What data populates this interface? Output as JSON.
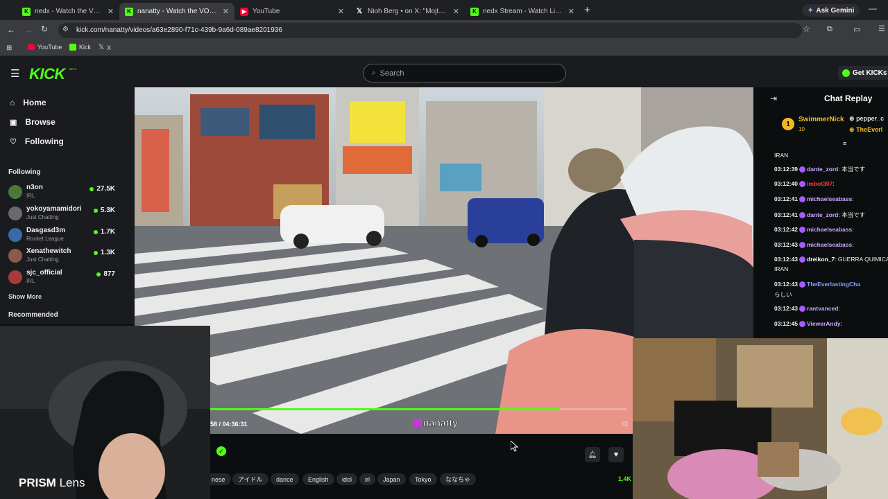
{
  "browser": {
    "tabs": [
      {
        "title": "nedx - Watch the VOD on Kick",
        "favicon": "kick",
        "active": false
      },
      {
        "title": "nanatty - Watch the VOD on Kick",
        "favicon": "kick",
        "active": true
      },
      {
        "title": "YouTube",
        "favicon": "youtube",
        "active": false
      },
      {
        "title": "Nioh Berg • on X: \"Mojtaba",
        "favicon": "x",
        "active": false
      },
      {
        "title": "nedx Stream - Watch Live on Kick",
        "favicon": "kick",
        "active": false
      }
    ],
    "new_tab": "+",
    "ask_gemini": "Ask Gemini",
    "url": "kick.com/nanatty/videos/a63e2890-f71c-439b-9a6d-089ae8201936",
    "bookmarks": [
      "YouTube",
      "Kick",
      "X"
    ]
  },
  "header": {
    "logo": "KICK",
    "search_placeholder": "Search",
    "get_kicks": "Get KICKs"
  },
  "sidebar": {
    "nav": [
      "Home",
      "Browse",
      "Following"
    ],
    "following_title": "Following",
    "following": [
      {
        "name": "n3on",
        "category": "IRL",
        "viewers": "27.5K",
        "color": "#4a7a3a"
      },
      {
        "name": "yokoyamamidori",
        "category": "Just Chatting",
        "viewers": "5.3K",
        "color": "#6a6a6a"
      },
      {
        "name": "Dasgasd3m",
        "category": "Rocket League",
        "viewers": "1.7K",
        "color": "#3a6aa8"
      },
      {
        "name": "Xenathewitch",
        "category": "Just Chatting",
        "viewers": "1.3K",
        "color": "#8a5a4a"
      },
      {
        "name": "sjc_official",
        "category": "IRL",
        "viewers": "877",
        "color": "#a83a3a"
      }
    ],
    "show_more": "Show More",
    "recommended_title": "Recommended"
  },
  "player": {
    "time": "58 / 04:36:31",
    "progress": 0.84,
    "watermark": "nanatty",
    "tags": [
      "nese",
      "アイドル",
      "dance",
      "English",
      "idol",
      "irl",
      "Japan",
      "Tokyo",
      "ななちゃ"
    ],
    "viewer_count": "1.4K"
  },
  "overlay": {
    "prism_bold": "PRISM",
    "prism_light": "Lens"
  },
  "chat": {
    "title": "Chat Replay",
    "pinned": {
      "rank": "1",
      "user": "SwimmerNick",
      "sub": "10",
      "user2": "pepper_c",
      "user3": "TheEverl"
    },
    "first_line": "IRAN",
    "messages": [
      {
        "time": "03:12:39",
        "user": "dante_zord",
        "color": "#c9a6ff",
        "text": ": 本当です"
      },
      {
        "time": "03:12:40",
        "user": "imbot307",
        "color": "#ff3b3b",
        "text": ":"
      },
      {
        "time": "03:12:41",
        "user": "michaelseabass",
        "color": "#c9a6ff",
        "text": ":"
      },
      {
        "time": "03:12:41",
        "user": "dante_zord",
        "color": "#c9a6ff",
        "text": ": 本当です"
      },
      {
        "time": "03:12:42",
        "user": "michaelseabass",
        "color": "#c9a6ff",
        "text": ":"
      },
      {
        "time": "03:12:43",
        "user": "michaelseabass",
        "color": "#c9a6ff",
        "text": ":"
      },
      {
        "time": "03:12:43",
        "user": "dreikon_7",
        "color": "#ffffff",
        "text": ": GUERRA QUIMICA"
      },
      {
        "time": "",
        "user": "",
        "color": "#ffffff",
        "text": "IRAN"
      },
      {
        "time": "03:12:43",
        "user": "TheEverlastingCha",
        "color": "#8aa0ff",
        "text": ""
      },
      {
        "time": "",
        "user": "",
        "color": "#ffffff",
        "text": "らしい"
      },
      {
        "time": "03:12:43",
        "user": "rantvanced",
        "color": "#c9a6ff",
        "text": ":"
      },
      {
        "time": "03:12:45",
        "user": "ViewerAndy",
        "color": "#c9a6ff",
        "text": ":"
      }
    ]
  },
  "colors": {
    "kick_green": "#53fc18",
    "bg": "#0b0e0f",
    "panel": "#191b1f"
  }
}
